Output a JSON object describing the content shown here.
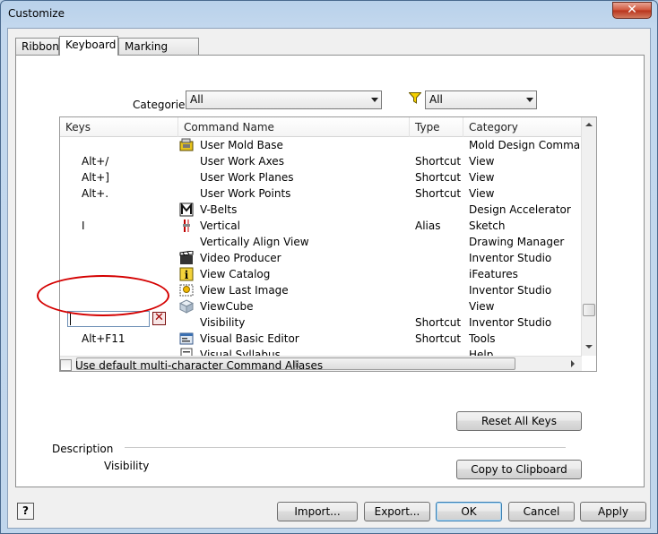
{
  "window": {
    "title": "Customize",
    "close_glyph": "✕"
  },
  "tabs": [
    {
      "label": "Ribbon"
    },
    {
      "label": "Keyboard",
      "active": true
    },
    {
      "label": "Marking Menu"
    }
  ],
  "filters": {
    "categories_label": "Categories",
    "categories_value": "All",
    "filter_value": "All",
    "filter_icon": "funnel-icon"
  },
  "grid": {
    "columns": [
      "Keys",
      "Command Name",
      "Type",
      "Category"
    ],
    "rows": [
      {
        "keys": "",
        "icon": "mold-base-icon",
        "command": "User Mold Base",
        "type": "",
        "category": "Mold Design Command"
      },
      {
        "keys": "Alt+/",
        "icon": "",
        "command": "User Work Axes",
        "type": "Shortcut",
        "category": "View"
      },
      {
        "keys": "Alt+]",
        "icon": "",
        "command": "User Work Planes",
        "type": "Shortcut",
        "category": "View"
      },
      {
        "keys": "Alt+.",
        "icon": "",
        "command": "User Work Points",
        "type": "Shortcut",
        "category": "View"
      },
      {
        "keys": "",
        "icon": "v-belts-icon",
        "command": "V-Belts",
        "type": "",
        "category": "Design Accelerator"
      },
      {
        "keys": "I",
        "icon": "vertical-constraint-icon",
        "command": "Vertical",
        "type": "Alias",
        "category": "Sketch"
      },
      {
        "keys": "",
        "icon": "",
        "command": "Vertically Align View",
        "type": "",
        "category": "Drawing Manager"
      },
      {
        "keys": "",
        "icon": "video-producer-icon",
        "command": "Video Producer",
        "type": "",
        "category": "Inventor Studio"
      },
      {
        "keys": "",
        "icon": "info-catalog-icon",
        "command": "View Catalog",
        "type": "",
        "category": "iFeatures"
      },
      {
        "keys": "",
        "icon": "last-image-icon",
        "command": "View Last Image",
        "type": "",
        "category": "Inventor Studio"
      },
      {
        "keys": "",
        "icon": "viewcube-icon",
        "command": "ViewCube",
        "type": "",
        "category": "View"
      },
      {
        "keys": "",
        "icon": "",
        "command": "Visibility",
        "type": "Shortcut",
        "category": "Inventor Studio",
        "editing": true
      },
      {
        "keys": "Alt+F11",
        "icon": "vba-editor-icon",
        "command": "Visual Basic Editor",
        "type": "Shortcut",
        "category": "Tools"
      },
      {
        "keys": "",
        "icon": "syllabus-icon",
        "command": "Visual Syllabus",
        "type": "",
        "category": "Help"
      }
    ],
    "key_input_value": "",
    "clear_key_glyph": "✕",
    "hscroll_grip": "|||"
  },
  "options": {
    "default_aliases_label": "Use default multi-character Command Aliases",
    "default_aliases_checked": false
  },
  "buttons": {
    "reset_all_keys": "Reset All Keys",
    "copy_to_clipboard": "Copy to Clipboard",
    "import": "Import...",
    "export": "Export...",
    "ok": "OK",
    "cancel": "Cancel",
    "apply": "Apply",
    "help_glyph": "?"
  },
  "description": {
    "label": "Description",
    "value": "Visibility"
  },
  "colors": {
    "annotation": "#d40000",
    "default_button_border": "#3c7fb1"
  }
}
